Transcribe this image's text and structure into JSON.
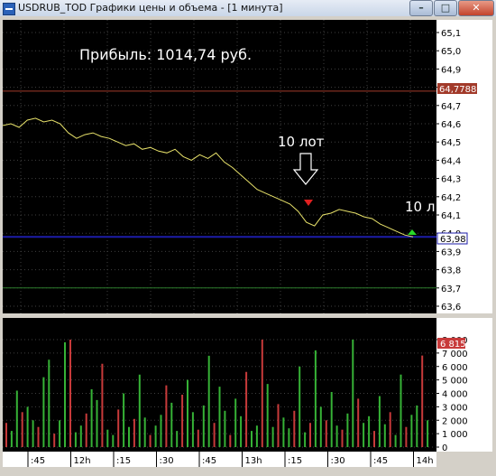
{
  "window": {
    "title": "USDRUB_TOD Графики цены и объема - [1 минута]",
    "buttons": {
      "minimize": "–",
      "maximize": "□",
      "close": "✕"
    }
  },
  "annotations": {
    "profit": "Прибыль: 1014,74 руб.",
    "lot_label_1": "10 лот",
    "lot_label_2": "10 л"
  },
  "colors": {
    "chart_bg": "#000000",
    "grid": "#3f3f3f",
    "price_line": "#e8e26a",
    "red_level": "#a23a2a",
    "blue_level": "#1c1ca8",
    "green_level": "#2c7a2c",
    "volume_up": "#36b236",
    "volume_down": "#c83a3a",
    "sell_marker": "#e02020",
    "buy_marker": "#28d828"
  },
  "price_panel": {
    "y_ticks": [
      "65,1",
      "65,0",
      "64,9",
      "64,8",
      "64,7",
      "64,6",
      "64,5",
      "64,4",
      "64,3",
      "64,2",
      "64,1",
      "64,0",
      "63,9",
      "63,8",
      "63,7",
      "63,6"
    ],
    "levels": {
      "red": "64,7788",
      "blue": "63,98"
    },
    "green_level_value": 63.7
  },
  "volume_panel": {
    "y_ticks": [
      "8 000",
      "7 000",
      "6 000",
      "5 000",
      "4 000",
      "3 000",
      "2 000",
      "1 000",
      "0"
    ],
    "last_value_label": "6 815"
  },
  "time_axis": {
    "labels": [
      ":45",
      "12h",
      ":15",
      ":30",
      ":45",
      "13h",
      ":15",
      ":30",
      ":45",
      "14h"
    ]
  },
  "chart_data": [
    {
      "type": "line",
      "name": "price",
      "ylim": [
        63.6,
        65.1
      ],
      "values": [
        64.59,
        64.6,
        64.58,
        64.62,
        64.63,
        64.61,
        64.62,
        64.6,
        64.55,
        64.52,
        64.54,
        64.55,
        64.53,
        64.52,
        64.5,
        64.48,
        64.49,
        64.46,
        64.47,
        64.45,
        64.44,
        64.46,
        64.42,
        64.4,
        64.43,
        64.41,
        64.44,
        64.39,
        64.36,
        64.32,
        64.28,
        64.24,
        64.22,
        64.2,
        64.18,
        64.16,
        64.12,
        64.06,
        64.04,
        64.1,
        64.11,
        64.13,
        64.12,
        64.11,
        64.09,
        64.08,
        64.05,
        64.03,
        64.01,
        63.99,
        63.98
      ]
    },
    {
      "type": "bar",
      "name": "volume",
      "ylim": [
        0,
        8000
      ],
      "values": [
        1800,
        1200,
        4200,
        2600,
        3000,
        2000,
        1500,
        5200,
        6500,
        1000,
        2000,
        7800,
        8000,
        1100,
        1600,
        2500,
        4300,
        3500,
        6200,
        1300,
        900,
        2800,
        4000,
        1500,
        2100,
        5400,
        2200,
        900,
        1600,
        2400,
        4600,
        3300,
        1200,
        3900,
        5000,
        2600,
        1300,
        3100,
        6800,
        1800,
        4500,
        2700,
        900,
        3600,
        2300,
        5600,
        1200,
        1600,
        8000,
        4700,
        1500,
        3200,
        2200,
        1400,
        2700,
        6000,
        1100,
        1800,
        7200,
        3000,
        2000,
        4100,
        1600,
        1300,
        2500,
        8000,
        3600,
        1800,
        2300,
        1200,
        3800,
        1700,
        2600,
        900,
        5400,
        1500,
        2400,
        3100,
        6815,
        2000
      ]
    }
  ]
}
